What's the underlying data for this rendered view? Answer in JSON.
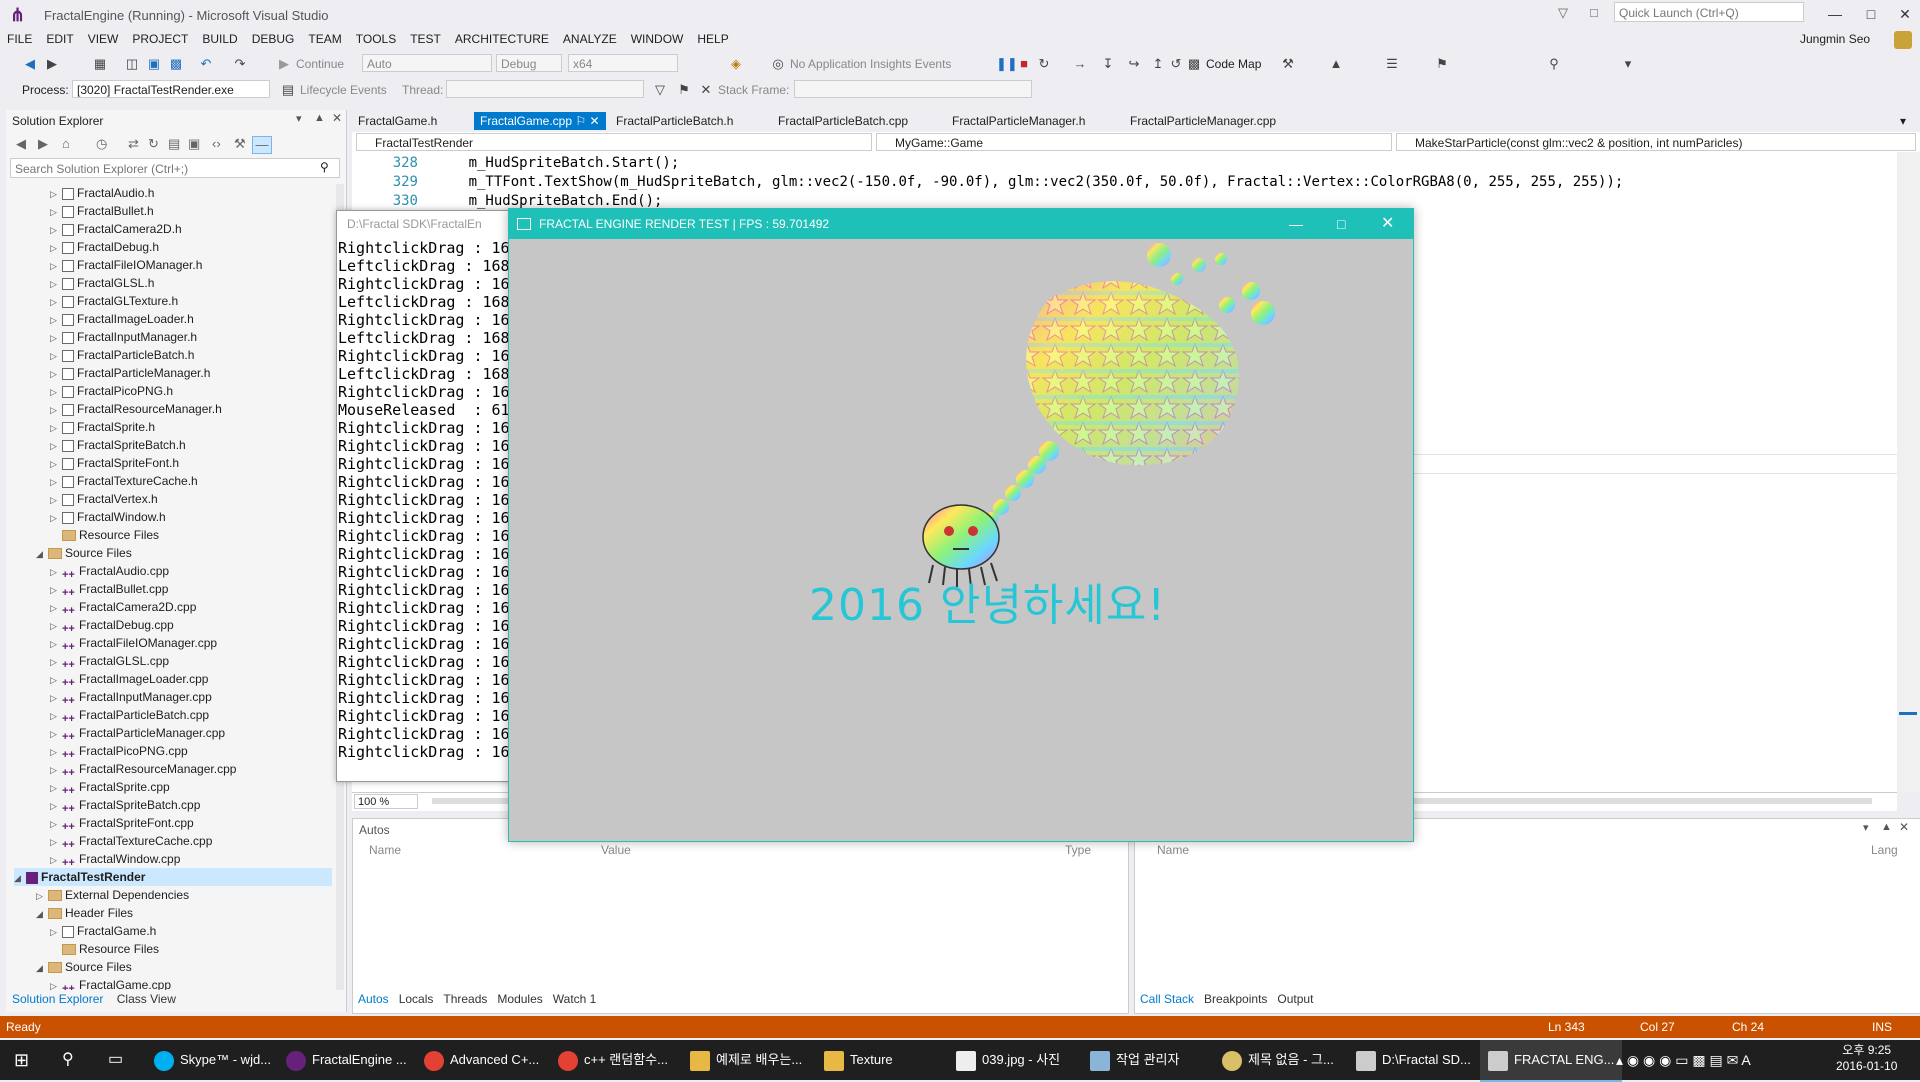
{
  "window": {
    "title": "FractalEngine (Running) - Microsoft Visual Studio",
    "quick_launch_placeholder": "Quick Launch (Ctrl+Q)",
    "user": "Jungmin Seo"
  },
  "menu": [
    "FILE",
    "EDIT",
    "VIEW",
    "PROJECT",
    "BUILD",
    "DEBUG",
    "TEAM",
    "TOOLS",
    "TEST",
    "ARCHITECTURE",
    "ANALYZE",
    "WINDOW",
    "HELP"
  ],
  "toolbar": {
    "continue_label": "Continue",
    "config_auto": "Auto",
    "config_debug": "Debug",
    "platform": "x64",
    "insights": "No Application Insights Events",
    "code_map": "Code Map",
    "process_label": "Process:",
    "process_value": "[3020] FractalTestRender.exe",
    "lifecycle": "Lifecycle Events",
    "thread_label": "Thread:",
    "stack_frame_label": "Stack Frame:"
  },
  "solution_explorer": {
    "title": "Solution Explorer",
    "search_placeholder": "Search Solution Explorer (Ctrl+;)",
    "header_files": [
      "FractalAudio.h",
      "FractalBullet.h",
      "FractalCamera2D.h",
      "FractalDebug.h",
      "FractalFileIOManager.h",
      "FractalGLSL.h",
      "FractalGLTexture.h",
      "FractalImageLoader.h",
      "FractalInputManager.h",
      "FractalParticleBatch.h",
      "FractalParticleManager.h",
      "FractalPicoPNG.h",
      "FractalResourceManager.h",
      "FractalSprite.h",
      "FractalSpriteBatch.h",
      "FractalSpriteFont.h",
      "FractalTextureCache.h",
      "FractalVertex.h",
      "FractalWindow.h"
    ],
    "resource_files": "Resource Files",
    "source_files": "Source Files",
    "source_list": [
      "FractalAudio.cpp",
      "FractalBullet.cpp",
      "FractalCamera2D.cpp",
      "FractalDebug.cpp",
      "FractalFileIOManager.cpp",
      "FractalGLSL.cpp",
      "FractalImageLoader.cpp",
      "FractalInputManager.cpp",
      "FractalParticleBatch.cpp",
      "FractalParticleManager.cpp",
      "FractalPicoPNG.cpp",
      "FractalResourceManager.cpp",
      "FractalSprite.cpp",
      "FractalSpriteBatch.cpp",
      "FractalSpriteFont.cpp",
      "FractalTextureCache.cpp",
      "FractalWindow.cpp"
    ],
    "project": "FractalTestRender",
    "external_deps": "External Dependencies",
    "header_files_label": "Header Files",
    "game_h": "FractalGame.h",
    "game_cpp": "FractalGame.cpp",
    "tabs": [
      "Solution Explorer",
      "Class View"
    ]
  },
  "editor": {
    "tabs": [
      "FractalGame.h",
      "FractalGame.cpp",
      "FractalParticleBatch.h",
      "FractalParticleBatch.cpp",
      "FractalParticleManager.h",
      "FractalParticleManager.cpp"
    ],
    "nav_project": "FractalTestRender",
    "nav_class": "MyGame::Game",
    "nav_member": "MakeStarParticle(const glm::vec2 & position, int numParicles)",
    "lines": [
      {
        "num": "328",
        "code": "    m_HudSpriteBatch.Start();"
      },
      {
        "num": "329",
        "code": "    m_TTFont.TextShow(m_HudSpriteBatch, glm::vec2(-150.0f, -90.0f), glm::vec2(350.0f, 50.0f), Fractal::Vertex::ColorRGBA8(0, 255, 255, 255));"
      },
      {
        "num": "330",
        "code": "    m_HudSpriteBatch.End();"
      }
    ],
    "zoom": "100 %"
  },
  "autos": {
    "title": "Autos",
    "columns": [
      "Name",
      "Value",
      "Type"
    ],
    "tabs": [
      "Autos",
      "Locals",
      "Threads",
      "Modules",
      "Watch 1"
    ]
  },
  "callstack": {
    "columns": [
      "Name",
      "Lang"
    ],
    "tabs": [
      "Call Stack",
      "Breakpoints",
      "Output"
    ]
  },
  "status": {
    "ready": "Ready",
    "line": "Ln 343",
    "col": "Col 27",
    "ch": "Ch 24",
    "mode": "INS"
  },
  "console": {
    "title": "D:\\Fractal SDK\\FractalEn",
    "lines": [
      "RightclickDrag : 168/1",
      "LeftclickDrag : 168/16",
      "RightclickDrag : 168/1",
      "LeftclickDrag : 168/16",
      "RightclickDrag : 168/1",
      "LeftclickDrag : 168/16",
      "RightclickDrag : 168/1",
      "LeftclickDrag : 168/16",
      "RightclickDrag : 168/1",
      "MouseReleased  : 618/1",
      "RightclickDrag : 168/1",
      "RightclickDrag : 168/1",
      "RightclickDrag : 168/1",
      "RightclickDrag : 168/1",
      "RightclickDrag : 168/1",
      "RightclickDrag : 168/1",
      "RightclickDrag : 168/1",
      "RightclickDrag : 168/1",
      "RightclickDrag : 168/1",
      "RightclickDrag : 168/1",
      "RightclickDrag : 168/1",
      "RightclickDrag : 168/1",
      "RightclickDrag : 168/1",
      "RightclickDrag : 168/1",
      "RightclickDrag : 168/1",
      "RightclickDrag : 168/1",
      "RightclickDrag : 168/1",
      "RightclickDrag : 168/1",
      "RightclickDrag : 168/1"
    ]
  },
  "render_window": {
    "title": "FRACTAL ENGINE RENDER TEST | FPS : 59.701492",
    "hud_text": "2016 안녕하세요!"
  },
  "taskbar": {
    "items": [
      "Skype™ - wjd...",
      "FractalEngine ...",
      "Advanced C+...",
      "c++ 랜덤함수...",
      "예제로 배우는...",
      "Texture",
      "039.jpg - 사진",
      "작업 관리자",
      "제목 없음 - 그...",
      "D:\\Fractal SD...",
      "FRACTAL ENG..."
    ],
    "time": "오후 9:25",
    "date": "2016-01-10"
  },
  "colors": {
    "accent": "#007acc",
    "status_bar": "#ca5100",
    "render_title": "#1ec0b8",
    "hud_text": "#27c6d6"
  }
}
